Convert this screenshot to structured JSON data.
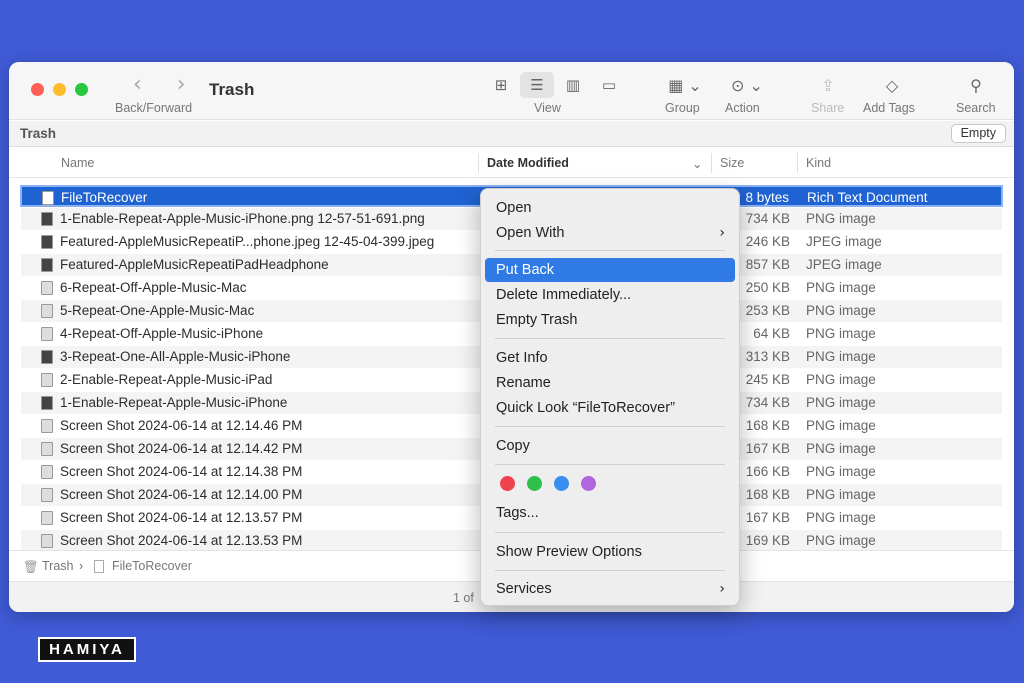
{
  "window": {
    "title": "Trash",
    "nav_arrows": "‹ ›",
    "toolbar": {
      "back_forward_label": "Back/Forward",
      "view_label": "View",
      "group_label": "Group",
      "action_label": "Action",
      "share_label": "Share",
      "add_tags_label": "Add Tags",
      "search_label": "Search"
    },
    "icons": {
      "icon_view": "⊞",
      "list_view": "☰",
      "column_view": "▥",
      "gallery_view": "▭",
      "group": "▦ ⌄",
      "action": "⊙ ⌄",
      "share": "⇪",
      "tag": "◇",
      "search": "⚲"
    }
  },
  "path": {
    "title": "Trash",
    "empty_button": "Empty"
  },
  "columns": {
    "name": "Name",
    "date": "Date Modified",
    "date_chevron": "⌄",
    "size": "Size",
    "kind": "Kind"
  },
  "files": [
    {
      "name": "FileToRecover",
      "size": "8 bytes",
      "kind": "Rich Text Document"
    },
    {
      "name": "1-Enable-Repeat-Apple-Music-iPhone.png 12-57-51-691.png",
      "size": "734 KB",
      "kind": "PNG image"
    },
    {
      "name": "Featured-AppleMusicRepeatiP...phone.jpeg 12-45-04-399.jpeg",
      "size": "246 KB",
      "kind": "JPEG image"
    },
    {
      "name": "Featured-AppleMusicRepeatiPadHeadphone",
      "size": "857 KB",
      "kind": "JPEG image"
    },
    {
      "name": "6-Repeat-Off-Apple-Music-Mac",
      "size": "250 KB",
      "kind": "PNG image"
    },
    {
      "name": "5-Repeat-One-Apple-Music-Mac",
      "size": "253 KB",
      "kind": "PNG image"
    },
    {
      "name": "4-Repeat-Off-Apple-Music-iPhone",
      "size": "64 KB",
      "kind": "PNG image"
    },
    {
      "name": "3-Repeat-One-All-Apple-Music-iPhone",
      "size": "313 KB",
      "kind": "PNG image"
    },
    {
      "name": "2-Enable-Repeat-Apple-Music-iPad",
      "size": "245 KB",
      "kind": "PNG image"
    },
    {
      "name": "1-Enable-Repeat-Apple-Music-iPhone",
      "size": "734 KB",
      "kind": "PNG image"
    },
    {
      "name": "Screen Shot 2024-06-14 at 12.14.46 PM",
      "size": "168 KB",
      "kind": "PNG image"
    },
    {
      "name": "Screen Shot 2024-06-14 at 12.14.42 PM",
      "size": "167 KB",
      "kind": "PNG image"
    },
    {
      "name": "Screen Shot 2024-06-14 at 12.14.38 PM",
      "size": "166 KB",
      "kind": "PNG image"
    },
    {
      "name": "Screen Shot 2024-06-14 at 12.14.00 PM",
      "size": "168 KB",
      "kind": "PNG image"
    },
    {
      "name": "Screen Shot 2024-06-14 at 12.13.57 PM",
      "size": "167 KB",
      "kind": "PNG image"
    },
    {
      "name": "Screen Shot 2024-06-14 at 12.13.53 PM",
      "size": "169 KB",
      "kind": "PNG image"
    }
  ],
  "breadcrumb": {
    "root": "Trash",
    "separator": "›",
    "item": "FileToRecover"
  },
  "status": {
    "text": "1 of"
  },
  "context_menu": {
    "open": "Open",
    "open_with": "Open With",
    "put_back": "Put Back",
    "delete_immediately": "Delete Immediately...",
    "empty_trash": "Empty Trash",
    "get_info": "Get Info",
    "rename": "Rename",
    "quick_look": "Quick Look “FileToRecover”",
    "copy": "Copy",
    "tags": "Tags...",
    "show_preview_options": "Show Preview Options",
    "services": "Services",
    "submenu_chevron": "›",
    "tag_colors": [
      "#f0434f",
      "#2fbf4b",
      "#3a8ef0",
      "#b166dd"
    ]
  },
  "watermark": "HAMIYA",
  "colors": {
    "background": "#3f5bd6",
    "selection": "#1f62d1",
    "menu_highlight": "#2f7ae5"
  }
}
